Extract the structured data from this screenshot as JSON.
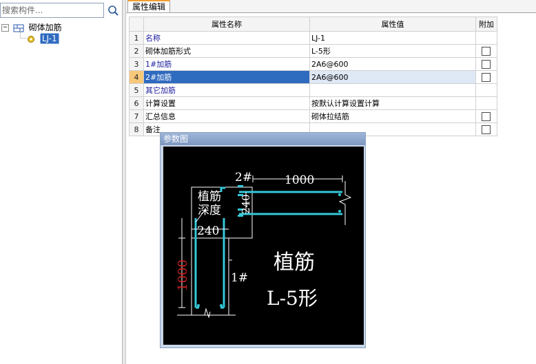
{
  "search": {
    "placeholder": "搜索构件..."
  },
  "tree": {
    "root_label": "砌体加筋",
    "child_label": "LJ-1",
    "expand_glyph": "−"
  },
  "tabs": [
    {
      "label": "属性编辑"
    }
  ],
  "grid": {
    "headers": {
      "name": "属性名称",
      "value": "属性值",
      "extra": "附加"
    },
    "rows": [
      {
        "idx": "1",
        "name": "名称",
        "value": "LJ-1",
        "checkbox": false
      },
      {
        "idx": "2",
        "name": "砌体加筋形式",
        "value": "L-5形",
        "checkbox": true
      },
      {
        "idx": "3",
        "name": "1#加筋",
        "value": "2A6@600",
        "checkbox": true
      },
      {
        "idx": "4",
        "name": "2#加筋",
        "value": "2A6@600",
        "checkbox": true,
        "selected": true
      },
      {
        "idx": "5",
        "name": "其它加筋",
        "value": "",
        "checkbox": false
      },
      {
        "idx": "6",
        "name": "计算设置",
        "value": "按默认计算设置计算",
        "checkbox": false
      },
      {
        "idx": "7",
        "name": "汇总信息",
        "value": "砌体拉结筋",
        "checkbox": true
      },
      {
        "idx": "8",
        "name": "备注",
        "value": "",
        "checkbox": true
      }
    ]
  },
  "popup": {
    "title": "参数图",
    "diagram": {
      "label_2": "2#",
      "dim_1000_top": "1000",
      "dim_240_vert": "240",
      "anchor_label_1": "植筋",
      "anchor_label_2": "深度",
      "dim_240_horiz": "240",
      "dim_1000_left": "1000",
      "label_1": "1#",
      "big_label_1": "植筋",
      "big_label_2": "L-5形"
    }
  },
  "colors": {
    "rebar": "#35c8d8",
    "dim_red": "#d02020",
    "selected_name_bg": "#2f6bbf",
    "header_value_bg": "#f8c87a",
    "tab_accent": "#f0a030"
  }
}
